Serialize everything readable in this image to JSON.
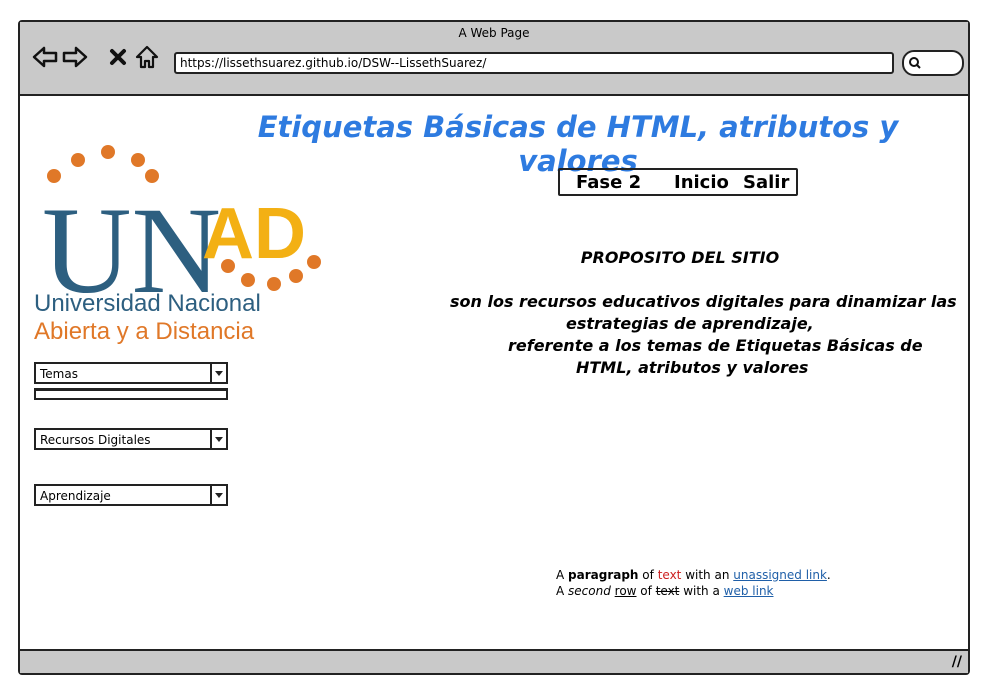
{
  "window": {
    "title": "A Web Page"
  },
  "browser": {
    "url": "https://lissethsuarez.github.io/DSW--LissethSuarez/"
  },
  "page": {
    "heading": "Etiquetas Básicas de HTML, atributos y valores",
    "heading_color": "#2e7be0",
    "logo": {
      "wordmark": "UNAD",
      "line1": "Universidad Nacional",
      "line2": "Abierta y a  Distancia"
    },
    "menu": {
      "items": [
        "Fase 2",
        "Inicio",
        "Salir"
      ]
    },
    "purpose": {
      "title": "PROPOSITO DEL SITIO",
      "lines": [
        "son los recursos educativos digitales para dinamizar las",
        "estrategias de aprendizaje,",
        "referente a los temas de Etiquetas Básicas de",
        "HTML, atributos y valores"
      ]
    },
    "dropdowns": [
      {
        "selected": "Temas"
      },
      {
        "selected": "Recursos Digitales"
      },
      {
        "selected": "Aprendizaje"
      }
    ],
    "paragraph": {
      "line1": {
        "a": "A ",
        "bold": "paragraph",
        "of": " of ",
        "red": "text",
        "with": " with an ",
        "link": "unassigned link",
        "end": "."
      },
      "line2": {
        "a": "A ",
        "italic": "second",
        "space": " ",
        "underline": "row",
        "of": " of ",
        "strike": "text",
        "with": " with a ",
        "link": "web link"
      }
    }
  },
  "colors": {
    "chrome": "#c9c9c9",
    "logo_blue": "#2d5f80",
    "logo_orange": "#e07828",
    "logo_yellow": "#f3b014",
    "link": "#1f5fa8",
    "red_text": "#cc1f1f"
  }
}
